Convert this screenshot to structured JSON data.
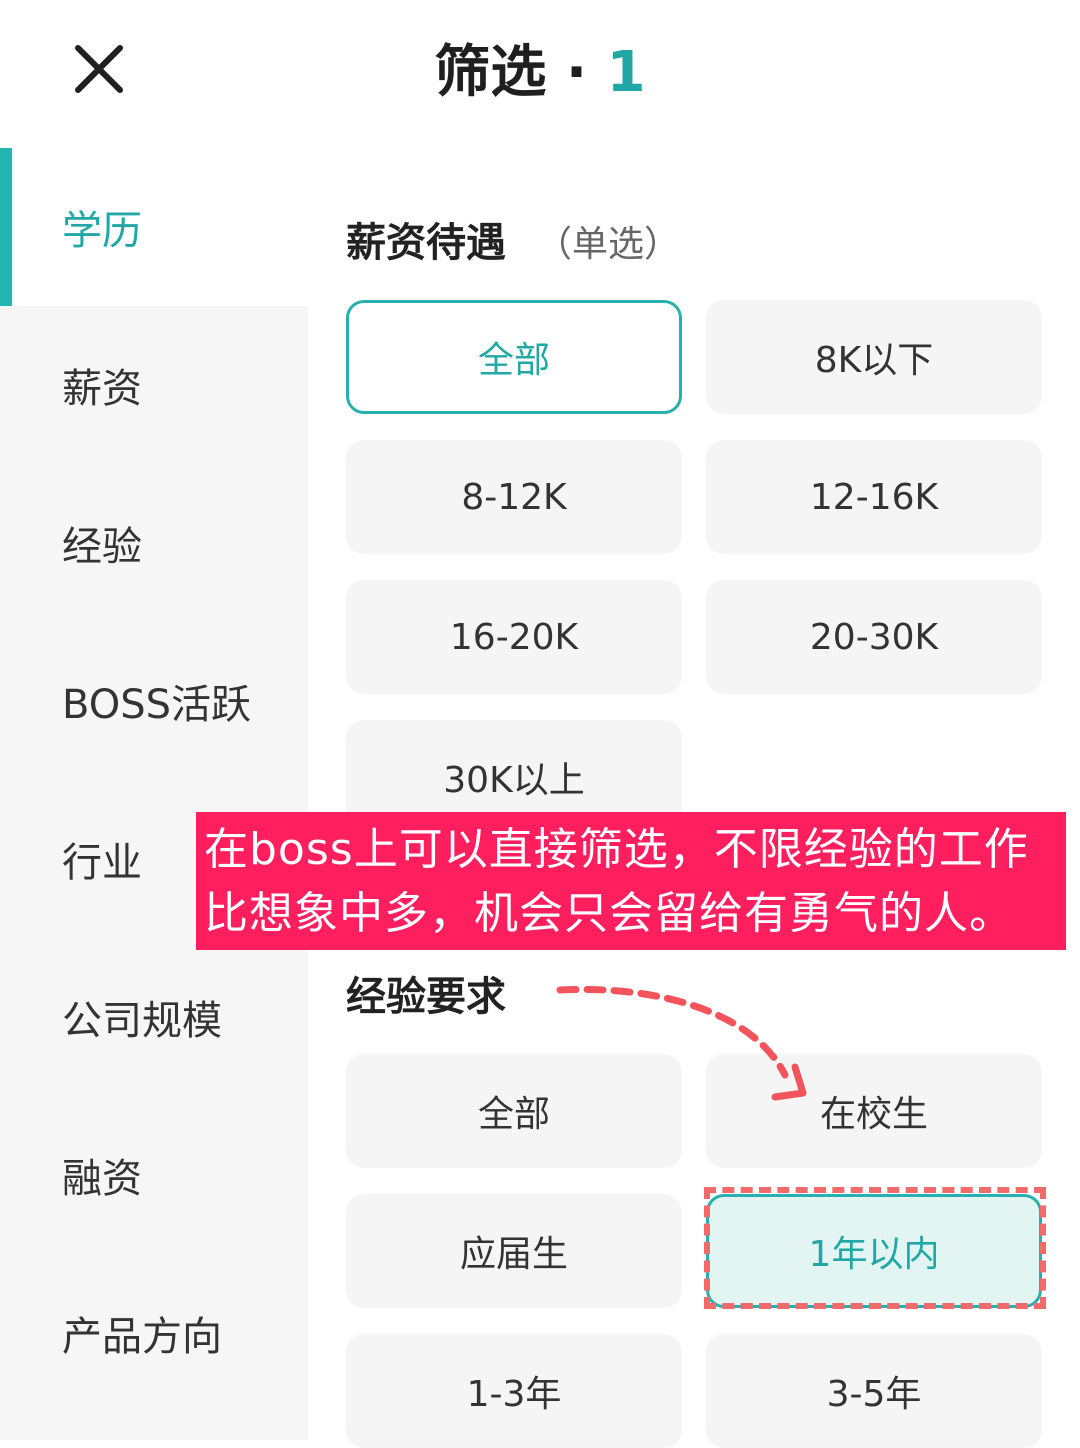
{
  "header": {
    "title": "筛选",
    "separator": " · ",
    "count": "1",
    "close_icon": "close-icon"
  },
  "sidebar": {
    "items": [
      {
        "label": "学历",
        "active": true
      },
      {
        "label": "薪资"
      },
      {
        "label": "经验"
      },
      {
        "label": "BOSS活跃"
      },
      {
        "label": "行业"
      },
      {
        "label": "公司规模"
      },
      {
        "label": "融资"
      },
      {
        "label": "产品方向"
      }
    ]
  },
  "salary": {
    "title": "薪资待遇",
    "hint": "（单选）",
    "options": [
      "全部",
      "8K以下",
      "8-12K",
      "12-16K",
      "16-20K",
      "20-30K",
      "30K以上"
    ],
    "selected": "全部"
  },
  "experience": {
    "title": "经验要求",
    "options": [
      "全部",
      "在校生",
      "应届生",
      "1年以内",
      "1-3年",
      "3-5年"
    ],
    "selected": "1年以内"
  },
  "annotation": {
    "line1": "在boss上可以直接筛选，不限经验的工作",
    "line2": "比想象中多，机会只会留给有勇气的人。"
  },
  "colors": {
    "accent": "#22a7a7",
    "banner": "#ff1f5f",
    "highlight_dash": "#f36a6a"
  }
}
